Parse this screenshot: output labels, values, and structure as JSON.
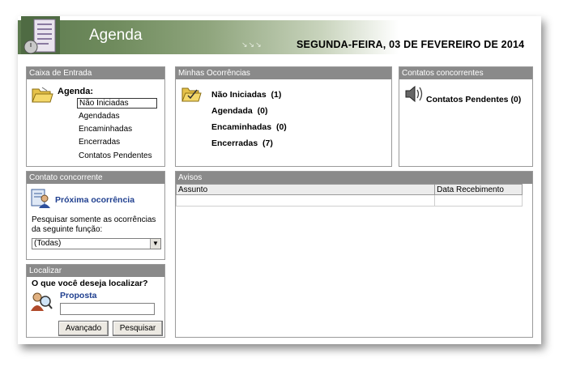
{
  "header": {
    "app_title": "Agenda",
    "arrows": "↘↘↘",
    "date": "SEGUNDA-FEIRA, 03  DE FEVEREIRO DE  2014"
  },
  "inbox": {
    "title": "Caixa de Entrada",
    "agenda_label": "Agenda:",
    "items": [
      "Não Iniciadas",
      "Agendadas",
      "Encaminhadas",
      "Encerradas",
      "Contatos Pendentes"
    ]
  },
  "occurrences": {
    "title": "Minhas Ocorrências",
    "items": [
      {
        "label": "Não Iniciadas",
        "count": "(1)"
      },
      {
        "label": "Agendada",
        "count": "(0)"
      },
      {
        "label": "Encaminhadas",
        "count": "(0)"
      },
      {
        "label": "Encerradas",
        "count": "(7)"
      }
    ]
  },
  "contacts": {
    "title": "Contatos concorrentes",
    "pending_label": "Contatos Pendentes",
    "pending_count": "(0)"
  },
  "concurrent": {
    "title": "Contato concorrente",
    "next_link": "Próxima ocorrência",
    "filter_text": "Pesquisar somente as ocorrências da seguinte função:",
    "select_value": "(Todas)"
  },
  "notices": {
    "title": "Avisos",
    "columns": [
      "Assunto",
      "Data Recebimento"
    ]
  },
  "locate": {
    "title": "Localizar",
    "question": "O que você deseja localizar?",
    "link": "Proposta",
    "input_value": "",
    "advanced_button": "Avançado",
    "search_button": "Pesquisar"
  }
}
